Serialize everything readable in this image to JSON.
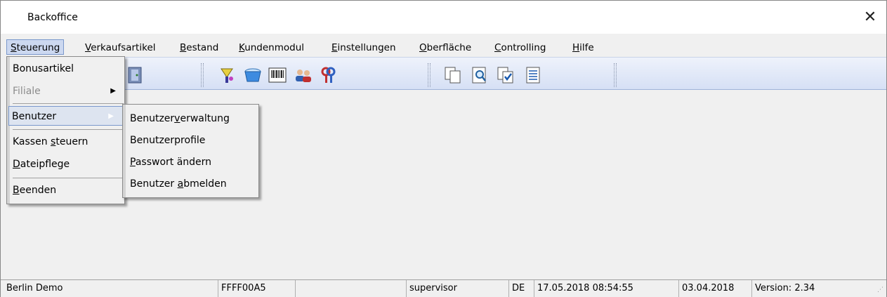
{
  "window": {
    "title": "Backoffice",
    "close_glyph": "✕"
  },
  "menubar": {
    "items": [
      {
        "label_pre": "",
        "accel": "S",
        "label_post": "teuerung"
      },
      {
        "label_pre": "",
        "accel": "V",
        "label_post": "erkaufsartikel"
      },
      {
        "label_pre": "",
        "accel": "B",
        "label_post": "estand"
      },
      {
        "label_pre": "",
        "accel": "K",
        "label_post": "undenmodul"
      },
      {
        "label_pre": "",
        "accel": "E",
        "label_post": "instellungen"
      },
      {
        "label_pre": "",
        "accel": "O",
        "label_post": "berfläche"
      },
      {
        "label_pre": "",
        "accel": "C",
        "label_post": "ontrolling"
      },
      {
        "label_pre": "",
        "accel": "H",
        "label_post": "ilfe"
      }
    ]
  },
  "toolbar": {
    "icons": [
      "exit-door-icon",
      "wand-icon",
      "basket-icon",
      "barcode-icon",
      "users-icon",
      "keys-icon",
      "copy-pages-icon",
      "search-doc-icon",
      "checked-doc-icon",
      "list-doc-icon"
    ]
  },
  "dropdown": {
    "items": [
      {
        "label": "Bonusartikel"
      },
      {
        "label": "Filiale",
        "arrow": "▶"
      },
      {
        "label": "Benutzer",
        "arrow": "▶"
      },
      {
        "label_pre": "Kassen ",
        "accel": "s",
        "label_post": "teuern"
      },
      {
        "label_pre": "",
        "accel": "D",
        "label_post": "ateipflege"
      },
      {
        "label_pre": "",
        "accel": "B",
        "label_post": "eenden"
      }
    ]
  },
  "submenu": {
    "items": [
      {
        "label_pre": "Benutzer",
        "accel": "v",
        "label_post": "erwaltung"
      },
      {
        "label_pre": "Benutzerprofile",
        "accel": "",
        "label_post": ""
      },
      {
        "label_pre": "",
        "accel": "P",
        "label_post": "asswort ändern"
      },
      {
        "label_pre": "Benutzer ",
        "accel": "a",
        "label_post": "bmelden"
      }
    ]
  },
  "statusbar": {
    "branch": "Berlin Demo",
    "code": "FFFF00A5",
    "blank": "",
    "user": "supervisor",
    "lang": "DE",
    "datetime": "17.05.2018 08:54:55",
    "date": "03.04.2018",
    "version": "Version: 2.34",
    "grip": "⋰"
  }
}
